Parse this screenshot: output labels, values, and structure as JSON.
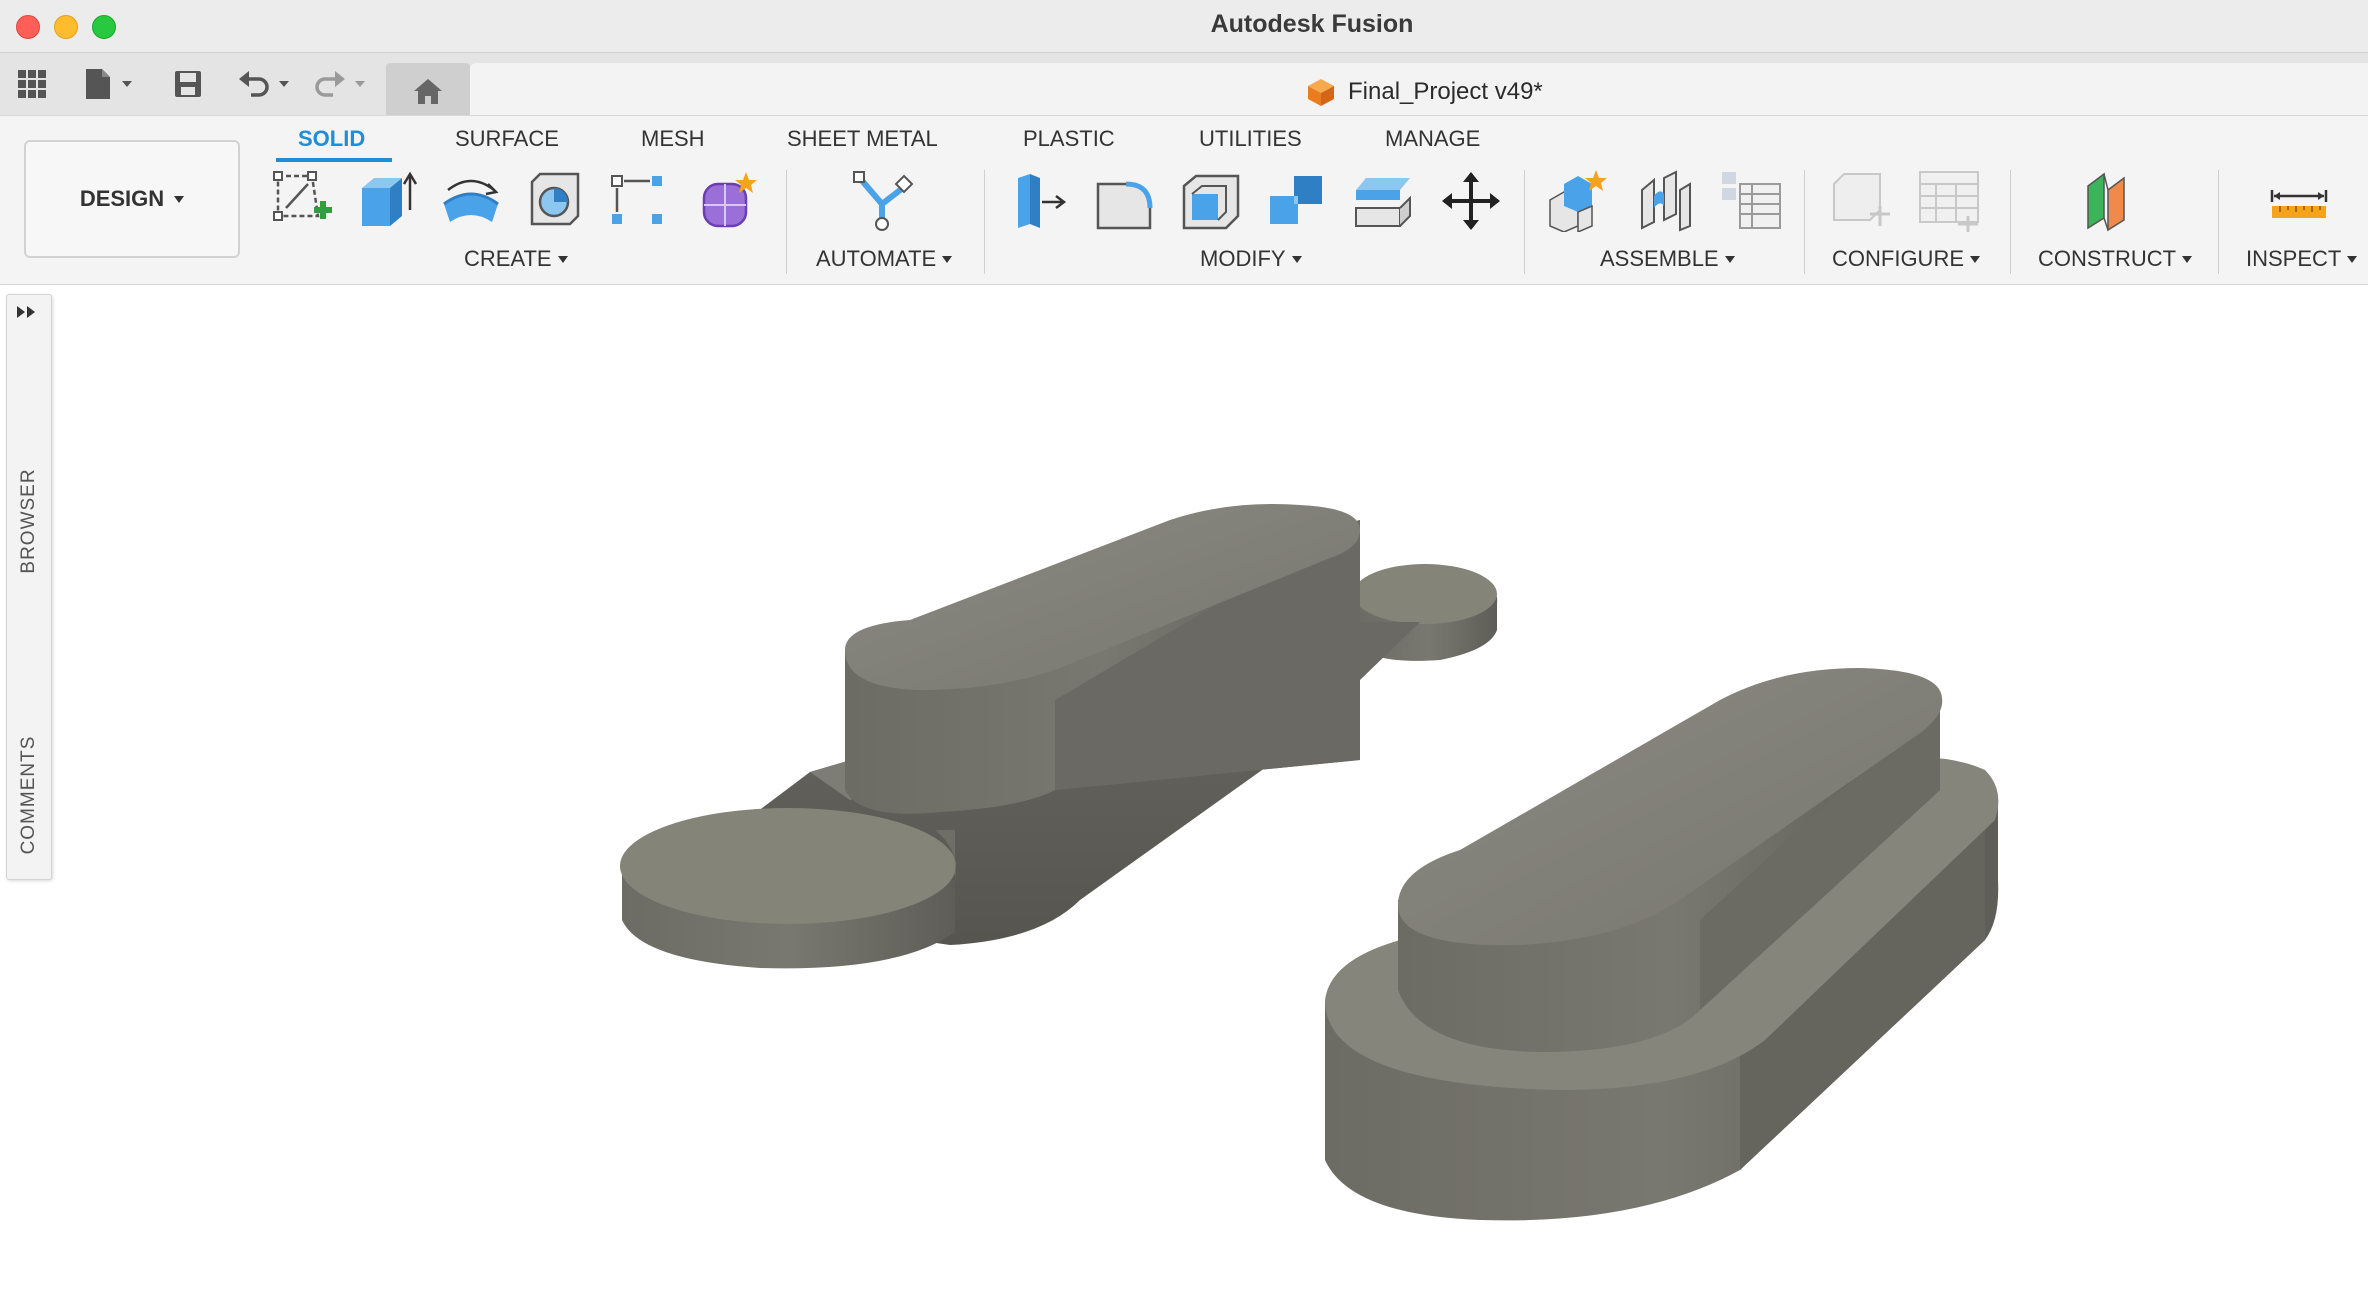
{
  "window": {
    "app_title": "Autodesk Fusion"
  },
  "quick_access": {
    "icons": [
      "grid-icon",
      "file-icon",
      "save-icon",
      "undo-icon",
      "redo-icon",
      "home-icon"
    ]
  },
  "document": {
    "title": "Final_Project v49*",
    "icon": "cube-icon",
    "icon_color": "#f28c28"
  },
  "workspace": {
    "label": "DESIGN"
  },
  "tabs": [
    {
      "label": "SOLID",
      "active": true
    },
    {
      "label": "SURFACE",
      "active": false
    },
    {
      "label": "MESH",
      "active": false
    },
    {
      "label": "SHEET METAL",
      "active": false
    },
    {
      "label": "PLASTIC",
      "active": false
    },
    {
      "label": "UTILITIES",
      "active": false
    },
    {
      "label": "MANAGE",
      "active": false
    }
  ],
  "groups": {
    "create": "CREATE",
    "automate": "AUTOMATE",
    "modify": "MODIFY",
    "assemble": "ASSEMBLE",
    "configure": "CONFIGURE",
    "construct": "CONSTRUCT",
    "inspect": "INSPECT"
  },
  "side_panel": {
    "browser": "BROWSER",
    "comments": "COMMENTS"
  },
  "colors": {
    "accent": "#1f8ed6",
    "tool_blue": "#4aa3e8",
    "model_gray": "#7b7a72"
  }
}
